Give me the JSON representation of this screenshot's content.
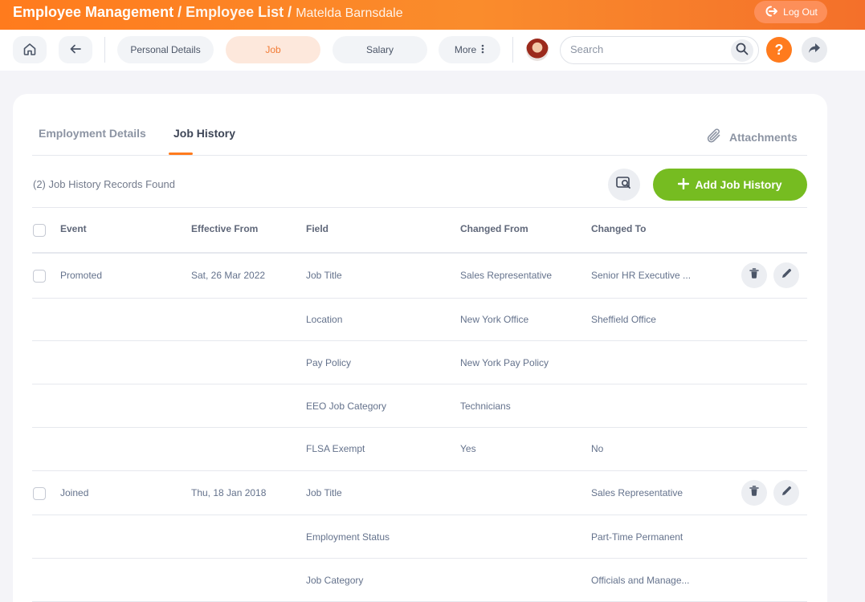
{
  "header": {
    "breadcrumb": [
      "Employee Management",
      "Employee List",
      "Matelda Barnsdale"
    ],
    "separator": "/",
    "logout_label": "Log Out"
  },
  "nav": {
    "home_icon": "home-icon",
    "back_icon": "arrow-left-icon",
    "tabs": [
      {
        "label": "Personal Details",
        "active": false
      },
      {
        "label": "Job",
        "active": true
      },
      {
        "label": "Salary",
        "active": false
      },
      {
        "label": "More",
        "active": false
      }
    ],
    "search_placeholder": "Search",
    "help_label": "?"
  },
  "content": {
    "tabs": [
      {
        "label": "Employment Details",
        "active": false
      },
      {
        "label": "Job History",
        "active": true
      }
    ],
    "attachments_label": "Attachments",
    "records_found": "(2) Job History Records Found",
    "add_button_label": "Add Job History",
    "columns": [
      "Event",
      "Effective From",
      "Field",
      "Changed From",
      "Changed To"
    ],
    "rows": [
      {
        "event": "Promoted",
        "effective_from": "Sat, 26 Mar 2022",
        "field": "Job Title",
        "changed_from": "Sales Representative",
        "changed_to": "Senior HR Executive ...",
        "record_start": true
      },
      {
        "event": "",
        "effective_from": "",
        "field": "Location",
        "changed_from": "New York Office",
        "changed_to": "Sheffield Office",
        "record_start": false
      },
      {
        "event": "",
        "effective_from": "",
        "field": "Pay Policy",
        "changed_from": "New York Pay Policy",
        "changed_to": "",
        "record_start": false
      },
      {
        "event": "",
        "effective_from": "",
        "field": "EEO Job Category",
        "changed_from": "Technicians",
        "changed_to": "",
        "record_start": false
      },
      {
        "event": "",
        "effective_from": "",
        "field": "FLSA Exempt",
        "changed_from": "Yes",
        "changed_to": "No",
        "record_start": false
      },
      {
        "event": "Joined",
        "effective_from": "Thu, 18 Jan 2018",
        "field": "Job Title",
        "changed_from": "",
        "changed_to": "Sales Representative",
        "record_start": true
      },
      {
        "event": "",
        "effective_from": "",
        "field": "Employment Status",
        "changed_from": "",
        "changed_to": "Part-Time Permanent",
        "record_start": false
      },
      {
        "event": "",
        "effective_from": "",
        "field": "Job Category",
        "changed_from": "",
        "changed_to": "Officials and Manage...",
        "record_start": false
      }
    ]
  },
  "colors": {
    "accent": "#ff7b1d",
    "add_button": "#76bc21",
    "active_tab_bg": "#fde8dc"
  }
}
